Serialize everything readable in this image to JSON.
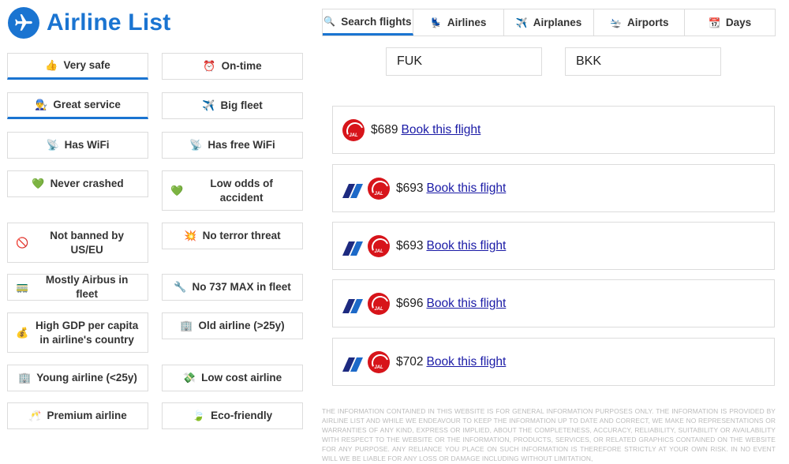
{
  "brand": {
    "title": "Airline List",
    "logo_icon": "airplane-icon",
    "color": "#1a74d1"
  },
  "filters": [
    {
      "emoji": "👍",
      "label": "Very safe",
      "active": true
    },
    {
      "emoji": "⏰",
      "label": "On-time",
      "active": false
    },
    {
      "emoji": "👨‍🔧",
      "label": "Great service",
      "active": true
    },
    {
      "emoji": "✈️",
      "label": "Big fleet",
      "active": false
    },
    {
      "emoji": "📡",
      "label": "Has WiFi",
      "active": false
    },
    {
      "emoji": "📡",
      "label": "Has free WiFi",
      "active": false
    },
    {
      "emoji": "💚",
      "label": "Never crashed",
      "active": false
    },
    {
      "emoji": "💚",
      "label": "Low odds of accident",
      "active": false
    },
    {
      "emoji": "🚫",
      "label": "Not banned by US/EU",
      "active": false
    },
    {
      "emoji": "💥",
      "label": "No terror threat",
      "active": false
    },
    {
      "emoji": "🚃",
      "label": "Mostly Airbus in fleet",
      "active": false
    },
    {
      "emoji": "🔧",
      "label": "No 737 MAX in fleet",
      "active": false
    },
    {
      "emoji": "💰",
      "label": "High GDP per capita in airline's country",
      "active": false
    },
    {
      "emoji": "🏢",
      "label": "Old airline (>25y)",
      "active": false
    },
    {
      "emoji": "🏢",
      "label": "Young airline (<25y)",
      "active": false
    },
    {
      "emoji": "💸",
      "label": "Low cost airline",
      "active": false
    },
    {
      "emoji": "🥂",
      "label": "Premium airline",
      "active": false
    },
    {
      "emoji": "🍃",
      "label": "Eco-friendly",
      "active": false
    }
  ],
  "tabs": [
    {
      "icon": "🔍",
      "label": "Search flights",
      "active": true
    },
    {
      "icon": "💺",
      "label": "Airlines",
      "active": false
    },
    {
      "icon": "✈️",
      "label": "Airplanes",
      "active": false
    },
    {
      "icon": "🛬",
      "label": "Airports",
      "active": false
    },
    {
      "icon": "📆",
      "label": "Days",
      "active": false
    }
  ],
  "search": {
    "from": "FUK",
    "to": "BKK"
  },
  "results": [
    {
      "airlines": [
        "JAL"
      ],
      "price": "$689",
      "link": "Book this flight"
    },
    {
      "airlines": [
        "ANA",
        "JAL"
      ],
      "price": "$693",
      "link": "Book this flight"
    },
    {
      "airlines": [
        "ANA",
        "JAL"
      ],
      "price": "$693",
      "link": "Book this flight"
    },
    {
      "airlines": [
        "ANA",
        "JAL"
      ],
      "price": "$696",
      "link": "Book this flight"
    },
    {
      "airlines": [
        "ANA",
        "JAL"
      ],
      "price": "$702",
      "link": "Book this flight"
    }
  ],
  "disclaimer": "The information contained in this website is for general information purposes only. The information is provided by Airline List and while we endeavour to keep the information up to date and correct, we make no representations or warranties of any kind, express or implied, about the completeness, accuracy, reliability, suitability or availability with respect to the website or the information, products, services, or related graphics contained on the website for any purpose. Any reliance you place on such information is therefore strictly at your own risk. In no event will we be liable for any loss or damage including without limitation,"
}
